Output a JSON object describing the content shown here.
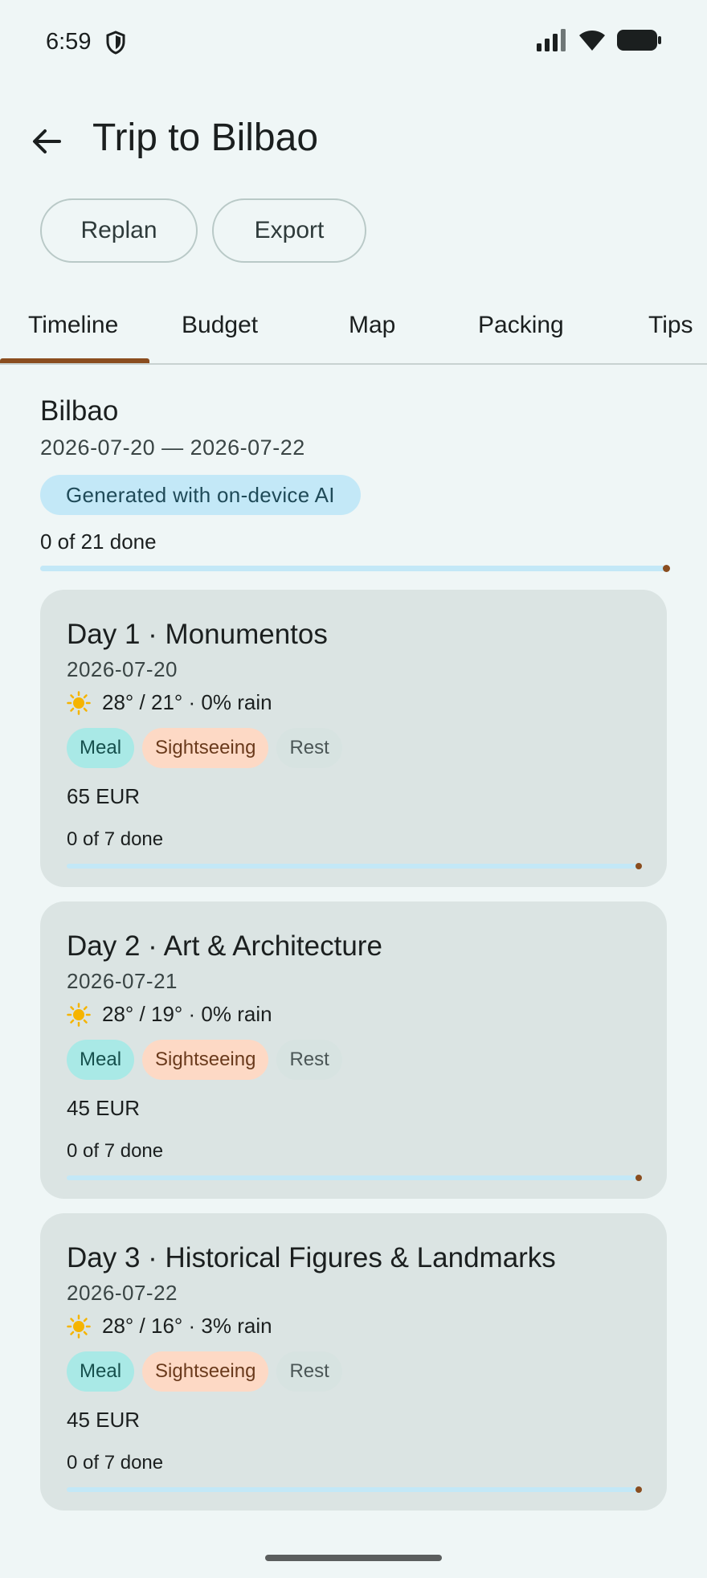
{
  "status_bar": {
    "time": "6:59"
  },
  "header": {
    "title": "Trip to Bilbao"
  },
  "actions": {
    "replan": "Replan",
    "export": "Export"
  },
  "tabs": [
    {
      "label": "Timeline",
      "selected": true
    },
    {
      "label": "Budget",
      "selected": false
    },
    {
      "label": "Map",
      "selected": false
    },
    {
      "label": "Packing",
      "selected": false
    },
    {
      "label": "Tips",
      "selected": false
    }
  ],
  "summary": {
    "city": "Bilbao",
    "dates": "2026-07-20 — 2026-07-22",
    "ai_badge": "Generated with on-device AI",
    "progress_label": "0 of 21 done",
    "progress": 0
  },
  "days": [
    {
      "title": "Day 1 · Monumentos",
      "date": "2026-07-20",
      "weather": "28° / 21° · 0% rain",
      "chips": [
        "Meal",
        "Sightseeing",
        "Rest"
      ],
      "cost": "65 EUR",
      "progress_label": "0 of 7 done",
      "progress": 0
    },
    {
      "title": "Day 2 · Art & Architecture",
      "date": "2026-07-21",
      "weather": "28° / 19° · 0% rain",
      "chips": [
        "Meal",
        "Sightseeing",
        "Rest"
      ],
      "cost": "45 EUR",
      "progress_label": "0 of 7 done",
      "progress": 0
    },
    {
      "title": "Day 3 · Historical Figures & Landmarks",
      "date": "2026-07-22",
      "weather": "28° / 16° · 3% rain",
      "chips": [
        "Meal",
        "Sightseeing",
        "Rest"
      ],
      "cost": "45 EUR",
      "progress_label": "0 of 7 done",
      "progress": 0
    }
  ],
  "colors": {
    "background": "#eff6f6",
    "accent": "#8a4d1f",
    "card": "#dbe4e3",
    "progress_track": "#c3e8f7",
    "chip_meal": "#a9e9e6",
    "chip_sightseeing": "#fdd9c5",
    "chip_rest": "#d7e3e1"
  },
  "icons": {
    "back": "arrow-left-icon",
    "weather": "sun-icon",
    "status_shield": "shield-icon",
    "signal": "signal-icon",
    "wifi": "wifi-icon",
    "battery": "battery-icon"
  }
}
